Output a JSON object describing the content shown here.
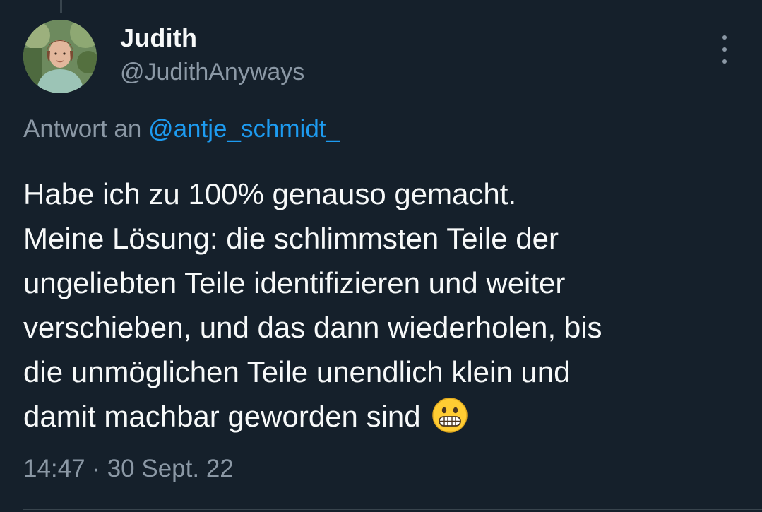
{
  "tweet": {
    "author": {
      "display_name": "Judith",
      "handle": "@JudithAnyways"
    },
    "reply_prefix": "Antwort an",
    "reply_to": "@antje_schmidt_",
    "text_lines": [
      "Habe ich zu 100% genauso gemacht.",
      "Meine Lösung: die schlimmsten Teile der",
      "ungeliebten Teile identifizieren und weiter",
      "verschieben, und das dann wiederholen, bis",
      "die unmöglichen Teile unendlich klein und",
      "damit machbar geworden sind"
    ],
    "emoji": "grimacing-face",
    "time": "14:47",
    "separator": "·",
    "date": "30 Sept. 22"
  },
  "colors": {
    "background": "#15202b",
    "primary_text": "#f7f9f9",
    "secondary_text": "#8b98a5",
    "link": "#1d9bf0",
    "divider": "#38444d"
  },
  "icons": {
    "more": "more-vertical-icon"
  }
}
